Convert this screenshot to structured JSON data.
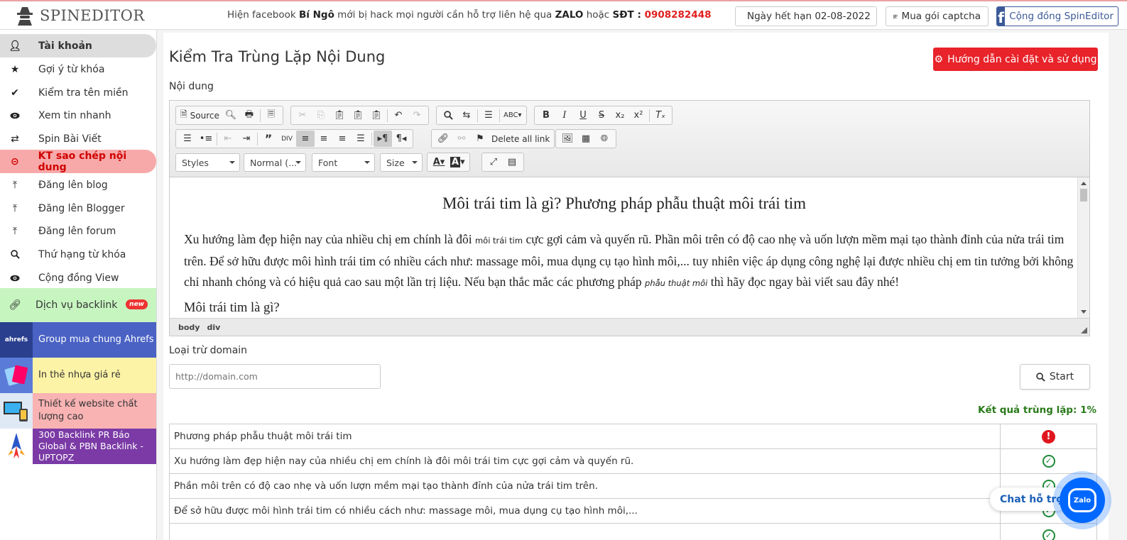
{
  "header": {
    "logo_text": "SPINEDITOR",
    "notice_prefix": "Hiện facebook ",
    "notice_name": "Bí Ngô",
    "notice_mid": " mới bị hack mọi người cần hỗ trợ liên hệ qua ",
    "notice_zalo": "ZALO",
    "notice_or": " hoặc ",
    "notice_sdt": "SĐT : ",
    "notice_phone": "0908282448",
    "expire_label": "Ngày hết hạn 02-08-2022",
    "captcha_label": "Mua gói captcha",
    "community_label": "Cộng đồng SpinEditor"
  },
  "sidebar": {
    "items": [
      {
        "label": "Tài khoản",
        "icon": "user-icon"
      },
      {
        "label": "Gợi ý từ khóa",
        "icon": "star-icon"
      },
      {
        "label": "Kiểm tra tên miền",
        "icon": "check-icon"
      },
      {
        "label": "Xem tin nhanh",
        "icon": "eye-icon"
      },
      {
        "label": "Spin Bài Viết",
        "icon": "shuffle-icon"
      },
      {
        "label": "KT sao chép nội dung",
        "icon": "copyright-icon"
      },
      {
        "label": "Đăng lên blog",
        "icon": "upload-icon"
      },
      {
        "label": "Đăng lên Blogger",
        "icon": "upload-icon"
      },
      {
        "label": "Đăng lên forum",
        "icon": "upload-icon"
      },
      {
        "label": "Thứ hạng từ khóa",
        "icon": "search-icon"
      },
      {
        "label": "Cộng đồng View",
        "icon": "eye-icon"
      }
    ],
    "backlink_label": "Dịch vụ backlink",
    "new_badge": "new",
    "promos": [
      {
        "label": "Group mua chung Ahrefs",
        "bg": "#4a62c4",
        "color": "#ffffff",
        "thumb_text": "ahrefs"
      },
      {
        "label": "In thẻ nhựa giá rẻ",
        "bg": "#fdf3a6",
        "color": "#333333",
        "thumb_text": ""
      },
      {
        "label": "Thiết kế website chất lượng cao",
        "bg": "#f9b3b3",
        "color": "#333333",
        "thumb_text": ""
      },
      {
        "label": "300 Backlink PR Báo Global & PBN Backlink - UPTOPZ",
        "bg": "#7b3aa6",
        "color": "#ffffff",
        "thumb_text": ""
      }
    ]
  },
  "main": {
    "title": "Kiểm Tra Trùng Lặp Nội Dung",
    "help_button": "Hướng dẫn cài đặt và sử dụng",
    "content_label": "Nội dung",
    "exclude_label": "Loại trừ domain",
    "domain_placeholder": "http://domain.com",
    "start_button": "Start",
    "result_label": "Kết quả trùng lặp: 1%"
  },
  "editor": {
    "source_label": "Source",
    "delete_links_label": "Delete all link",
    "combos": {
      "styles": "Styles",
      "format": "Normal (...",
      "font": "Font",
      "size": "Size"
    },
    "heading": "Môi trái tim là gì? Phương pháp phẫu thuật môi trái tim",
    "para_1": "Xu hướng làm đẹp hiện nay của nhiều chị em chính là đôi ",
    "para_kw1": "môi trái tim",
    "para_2": " cực gợi cảm và quyến rũ. Phần môi trên có độ cao nhẹ và uốn lượn mềm mại tạo thành đỉnh của nửa trái tim trên. Để sở hữu được môi hình trái tim có nhiều cách như: massage môi, mua dụng cụ tạo hình môi,... tuy nhiên việc áp dụng công nghệ lại được nhiều chị em tin tưởng bởi không chỉ nhanh chóng và có hiệu quả cao sau một lần trị liệu. Nếu bạn thắc mắc các phương pháp ",
    "para_kw2": "phẫu thuật môi",
    "para_3": " thì hãy đọc ngay bài viết sau đây nhé!",
    "subheading": "Môi trái tim là gì?",
    "path": [
      "body",
      "div"
    ]
  },
  "results": {
    "rows": [
      {
        "text": "Phương pháp phẫu thuật môi trái tim",
        "status": "duplicate"
      },
      {
        "text": "Xu hướng làm đẹp hiện nay của nhiều chị em chính là đôi môi trái tim cực gợi cảm và quyến rũ.",
        "status": "unique"
      },
      {
        "text": "Phần môi trên có độ cao nhẹ và uốn lượn mềm mại tạo thành đỉnh của nửa trái tim trên.",
        "status": "unique"
      },
      {
        "text": "Để sở hữu được môi hình trái tim có nhiều cách như: massage môi, mua dụng cụ tạo hình môi,...",
        "status": "unique"
      },
      {
        "text": "",
        "status": "unique"
      }
    ]
  },
  "chat": {
    "label": "Chat hỗ trợ",
    "icon_text": "Zalo"
  },
  "colors": {
    "accent_red": "#e8232a",
    "active_bg": "#f7a9a9",
    "success": "#1e8a36",
    "zalo": "#0068ff"
  }
}
